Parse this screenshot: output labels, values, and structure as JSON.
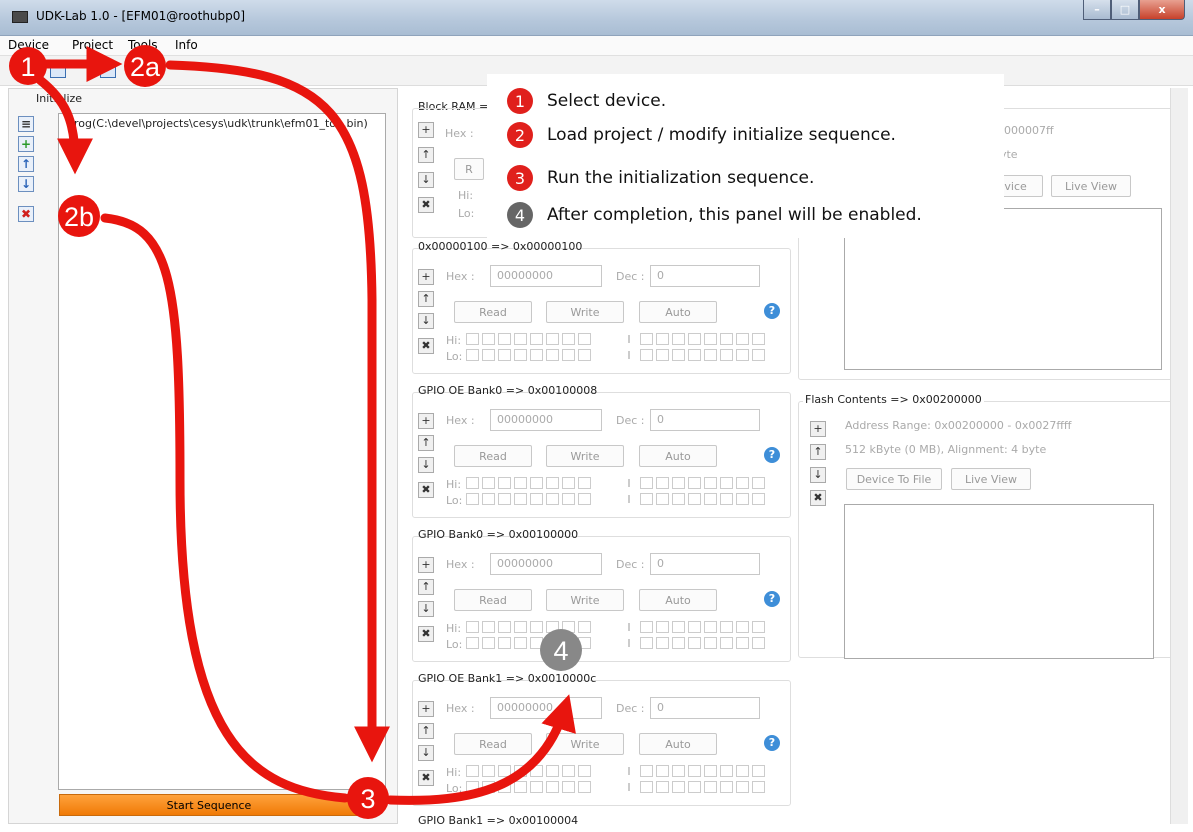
{
  "window": {
    "title": "UDK-Lab 1.0 - [EFM01@roothubp0]",
    "min": "–",
    "max": "□",
    "close": "x"
  },
  "menu": [
    "Device",
    "Project",
    "Tools",
    "Info"
  ],
  "left_panel": {
    "title": "Initialize",
    "item": "prog(C:\\devel\\projects\\cesys\\udk\\trunk\\efm01_top.bin)",
    "start_button": "Start Sequence",
    "side_buttons": {
      "add": "+",
      "up": "↑",
      "down": "↓",
      "remove": "✖"
    }
  },
  "labels": {
    "hex": "Hex :",
    "dec": "Dec :",
    "read": "Read",
    "write": "Write",
    "auto": "Auto",
    "hi": "Hi:",
    "lo": "Lo:",
    "help": "?"
  },
  "registers": [
    {
      "title": "0x00000100 => 0x00000100",
      "hex": "00000000",
      "dec": "0"
    },
    {
      "title": "GPIO OE Bank0 => 0x00100008",
      "hex": "00000000",
      "dec": "0"
    },
    {
      "title": "GPIO Bank0 => 0x00100000",
      "hex": "00000000",
      "dec": "0"
    },
    {
      "title": "GPIO OE Bank1 => 0x0010000c",
      "hex": "00000000",
      "dec": "0"
    }
  ],
  "block_ram": {
    "title": "Block RAM =>",
    "hex_label": "Hex :",
    "read_fragment": "R"
  },
  "bottom_register": {
    "title": "GPIO Bank1 => 0x00100004"
  },
  "block_ram_panel": {
    "range_fragment": "- 0x000007ff",
    "size_fragment": "byte",
    "device_button_fragment": "Device",
    "live_view": "Live View"
  },
  "flash_panel": {
    "title": "Flash Contents => 0x00200000",
    "range": "Address Range: 0x00200000 - 0x0027ffff",
    "size": "512 kByte (0 MB), Alignment: 4 byte",
    "device_to_file": "Device To File",
    "live_view": "Live View"
  },
  "callout": [
    {
      "num": "1",
      "text": "Select device.",
      "color": "#e0201c"
    },
    {
      "num": "2",
      "text": "Load project / modify initialize sequence.",
      "color": "#e0201c"
    },
    {
      "num": "3",
      "text": "Run the initialization sequence.",
      "color": "#e0201c"
    },
    {
      "num": "4",
      "text": "After completion, this panel will be enabled.",
      "color": "#666666"
    }
  ],
  "markers": {
    "m1": "1",
    "m2a": "2a",
    "m2b": "2b",
    "m3": "3",
    "m4": "4"
  },
  "colors": {
    "arrow": "#e8150e",
    "start_button": "#f58a14",
    "help": "#3e8ed8"
  }
}
